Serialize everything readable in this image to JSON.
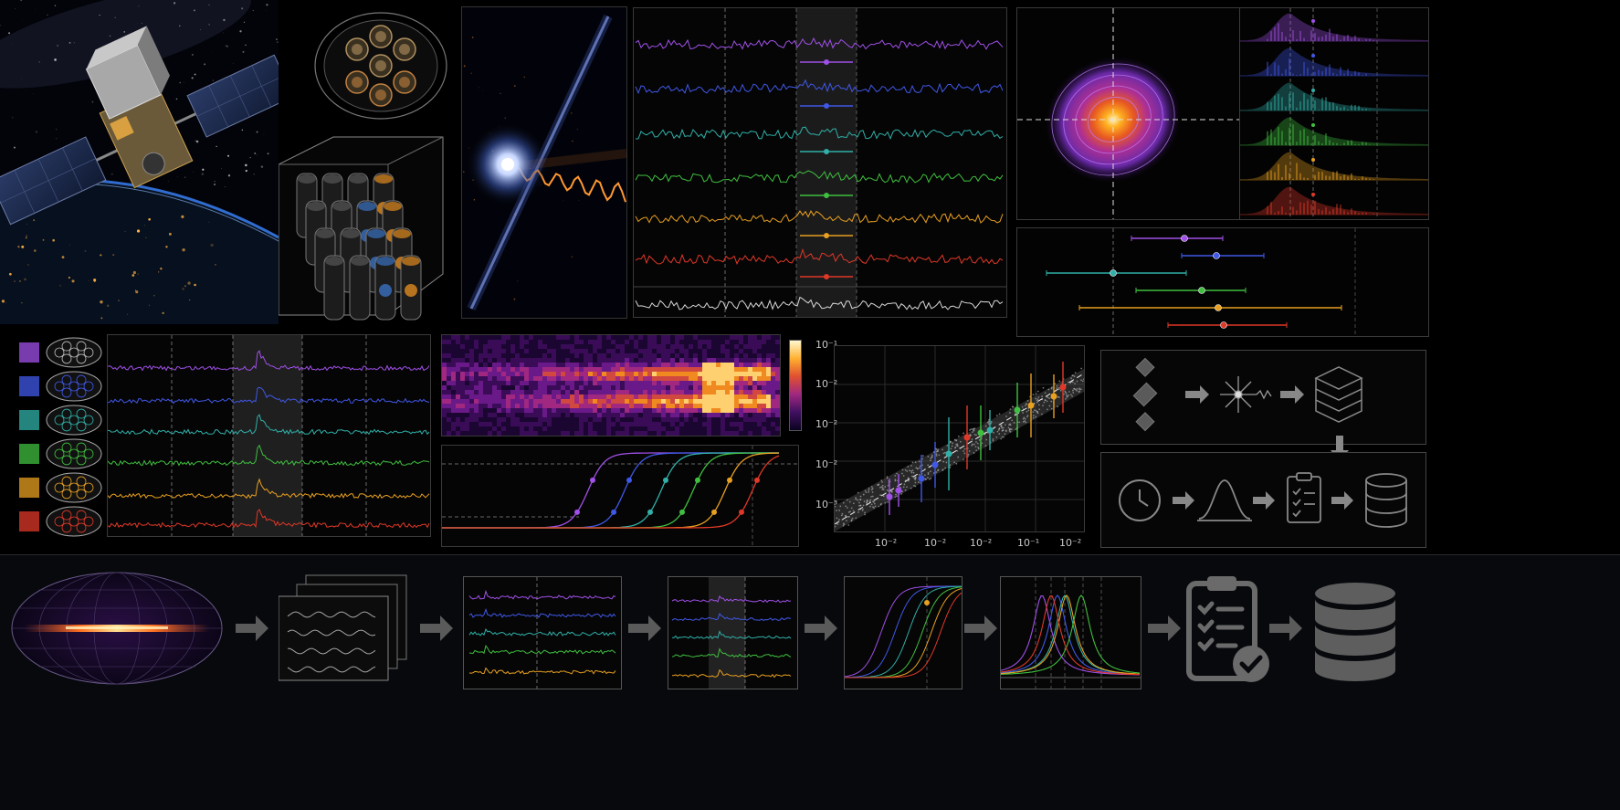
{
  "colors": {
    "purple": "#a050e8",
    "blue": "#4058e8",
    "teal": "#30b0a8",
    "green": "#40c040",
    "orange": "#e8a020",
    "red": "#e03828",
    "white": "#d8d8d8",
    "background": "#000000"
  },
  "series_order": [
    "purple",
    "blue",
    "teal",
    "green",
    "orange",
    "red"
  ],
  "icons": {
    "satellite": "satellite-icon",
    "burst": "burst-icon",
    "stack": "layer-stack-icon",
    "clock": "clock-icon",
    "gaussian": "gaussian-curve-icon",
    "checklist": "checklist-icon",
    "database": "database-icon",
    "arrow": "arrow-right-icon"
  },
  "scatter_panel": {
    "y_ticks": [
      "10⁻¹",
      "10⁻²",
      "10⁻²",
      "10⁻²",
      "10⁻³"
    ],
    "x_ticks": [
      "10⁻²",
      "10⁻²",
      "10⁻²",
      "10⁻¹",
      "10⁻²"
    ]
  }
}
